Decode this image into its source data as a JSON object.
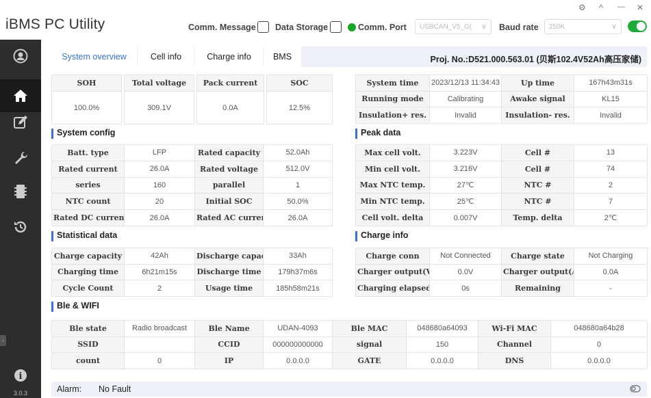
{
  "app": {
    "title": "iBMS PC Utility"
  },
  "toolbar": {
    "comm_message": "Comm. Message",
    "data_storage": "Data Storage",
    "comm_port": "Comm. Port",
    "port_value": "USBCAN_V5_G(",
    "baud_rate": "Baud rate",
    "baud_value": "250K",
    "status_color": "#19a52c"
  },
  "window": {
    "settings_icon": "⚙",
    "collapse": "^",
    "minimize": "—",
    "close": "✕"
  },
  "sidebar": {
    "items": [
      {
        "icon": "user-icon"
      },
      {
        "icon": "home-icon",
        "active": true
      },
      {
        "icon": "edit-icon"
      },
      {
        "icon": "wrench-icon"
      },
      {
        "icon": "battery-icon"
      },
      {
        "icon": "history-icon"
      }
    ],
    "info_icon": "i",
    "version": "3.0.3"
  },
  "tabs": [
    {
      "label": "System overview",
      "active": true
    },
    {
      "label": "Cell info"
    },
    {
      "label": "Charge info"
    },
    {
      "label": "BMS"
    }
  ],
  "project": "Proj. No.:D521.000.563.01 (贝斯102.4V52Ah高压家储)",
  "overview": {
    "headers": [
      "SOH",
      "Total voltage",
      "Pack current",
      "SOC"
    ],
    "values": [
      "100.0%",
      "309.1V",
      "0.0A",
      "12.5%"
    ]
  },
  "system_status": [
    [
      "System time",
      "2023/12/13 11:34:43",
      "Up time",
      "167h43m31s"
    ],
    [
      "Running mode",
      "Calibrating",
      "Awake signal",
      "KL15"
    ],
    [
      "Insulation+ res.",
      "Invalid",
      "Insulation- res.",
      "Invalid"
    ]
  ],
  "system_config": {
    "title": "System config",
    "rows": [
      [
        "Batt. type",
        "LFP",
        "Rated capacity",
        "52.0Ah"
      ],
      [
        "Rated current",
        "26.0A",
        "Rated voltage",
        "512.0V"
      ],
      [
        "series",
        "160",
        "parallel",
        "1"
      ],
      [
        "NTC count",
        "20",
        "Initial SOC",
        "50.0%"
      ],
      [
        "Rated DC current",
        "26.0A",
        "Rated AC current",
        "26.0A"
      ]
    ]
  },
  "peak_data": {
    "title": "Peak data",
    "rows": [
      [
        "Max cell volt.",
        "3.223V",
        "Cell #",
        "13"
      ],
      [
        "Min cell volt.",
        "3.216V",
        "Cell #",
        "74"
      ],
      [
        "Max NTC temp.",
        "27℃",
        "NTC #",
        "2"
      ],
      [
        "Min NTC temp.",
        "25℃",
        "NTC #",
        "7"
      ],
      [
        "Cell volt. delta",
        "0.007V",
        "Temp. delta",
        "2℃"
      ]
    ]
  },
  "statistical_data": {
    "title": "Statistical data",
    "rows": [
      [
        "Charge capacity",
        "42Ah",
        "Discharge capacity",
        "33Ah"
      ],
      [
        "Charging time",
        "6h21m15s",
        "Discharge time",
        "179h37m6s"
      ],
      [
        "Cycle Count",
        "2",
        "Usage time",
        "185h58m21s"
      ]
    ]
  },
  "charge_info": {
    "title": "Charge info",
    "rows": [
      [
        "Charge conn",
        "Not Connected",
        "Charge state",
        "Not Charging"
      ],
      [
        "Charger output(V)",
        "0.0V",
        "Charger output(A)",
        "0.0A"
      ],
      [
        "Charging elapsed",
        "0s",
        "Remaining",
        "-"
      ]
    ]
  },
  "ble_wifi": {
    "title": "Ble & WIFI",
    "rows": [
      [
        "Ble state",
        "Radio broadcast",
        "Ble Name",
        "UDAN-4093",
        "Ble MAC",
        "048680a64093",
        "Wi-Fi MAC",
        "048680a64b28"
      ],
      [
        "SSID",
        "",
        "CCID",
        "000000000000",
        "signal",
        "150",
        "Channel",
        "0"
      ],
      [
        "count",
        "0",
        "IP",
        "0.0.0.0",
        "GATE",
        "0.0.0.0",
        "DNS",
        "0.0.0.0"
      ]
    ]
  },
  "alarm": {
    "label": "Alarm:",
    "value": "No Fault"
  }
}
